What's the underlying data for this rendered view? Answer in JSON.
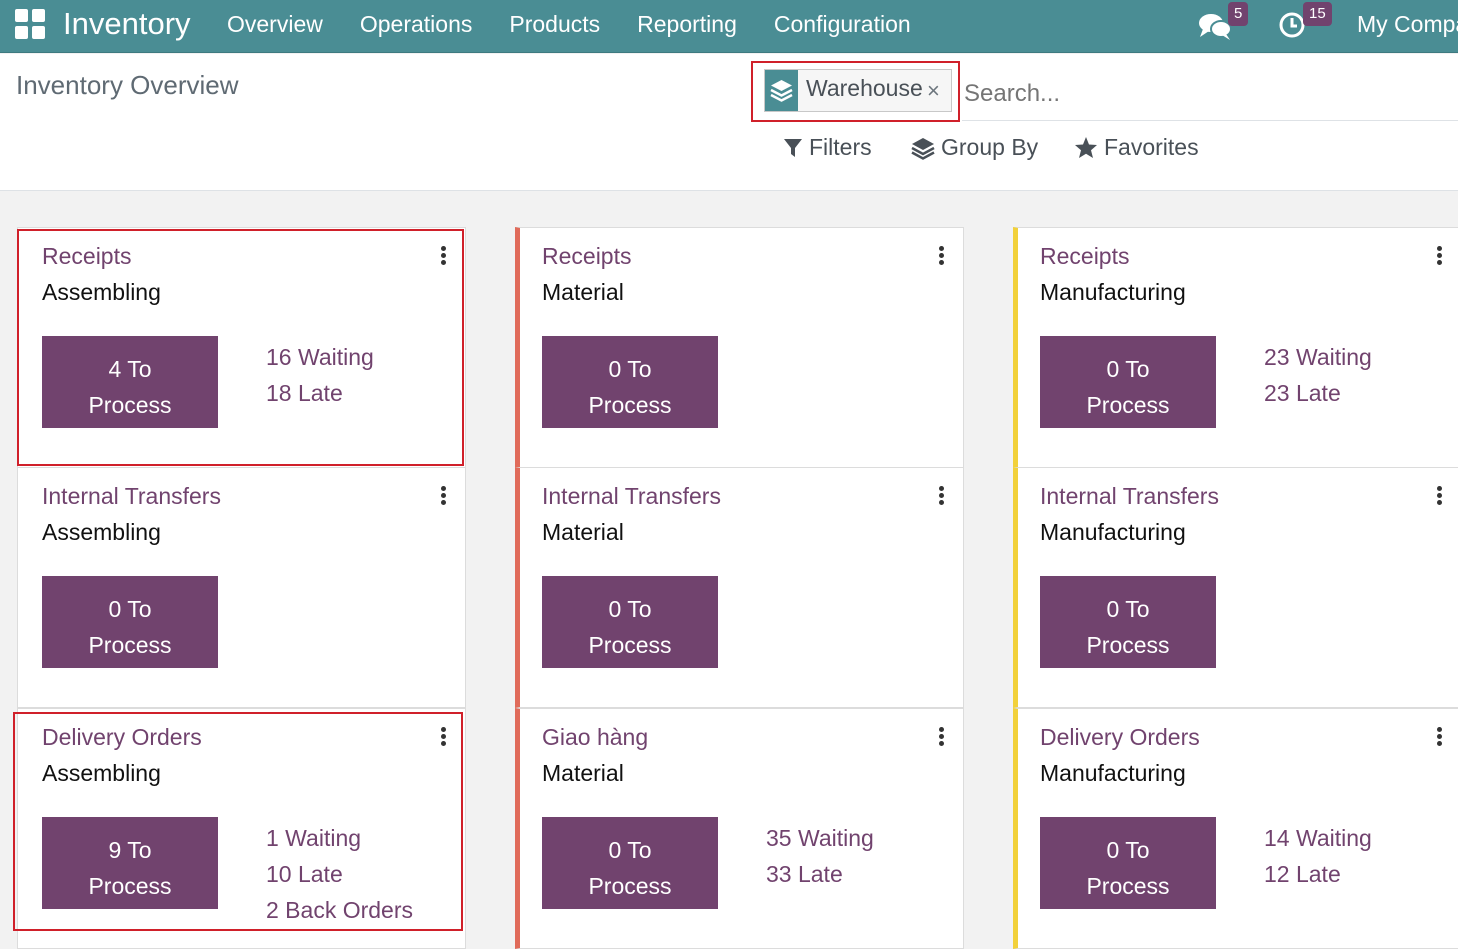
{
  "navbar": {
    "app_name": "Inventory",
    "menu": [
      "Overview",
      "Operations",
      "Products",
      "Reporting",
      "Configuration"
    ],
    "messages_count": "5",
    "activities_count": "15",
    "company": "My Company"
  },
  "control_panel": {
    "title": "Inventory Overview",
    "facet_label": "Warehouse",
    "facet_close": "×",
    "search_placeholder": "Search...",
    "filters_label": "Filters",
    "group_by_label": "Group By",
    "favorites_label": "Favorites"
  },
  "colors": {
    "navbar": "#4a8d94",
    "primary": "#71436e",
    "material_stripe": "#e06b5a",
    "manufacturing_stripe": "#f2d13a",
    "highlight": "#d0202a"
  },
  "cards": [
    {
      "title": "Receipts",
      "warehouse": "Assembling",
      "process_line1": "4 To",
      "process_line2": "Process",
      "stats": [
        "16 Waiting",
        "18 Late"
      ]
    },
    {
      "title": "Receipts",
      "warehouse": "Material",
      "process_line1": "0 To",
      "process_line2": "Process",
      "stats": []
    },
    {
      "title": "Receipts",
      "warehouse": "Manufacturing",
      "process_line1": "0 To",
      "process_line2": "Process",
      "stats": [
        "23 Waiting",
        "23 Late"
      ]
    },
    {
      "title": "Internal Transfers",
      "warehouse": "Assembling",
      "process_line1": "0 To",
      "process_line2": "Process",
      "stats": []
    },
    {
      "title": "Internal Transfers",
      "warehouse": "Material",
      "process_line1": "0 To",
      "process_line2": "Process",
      "stats": []
    },
    {
      "title": "Internal Transfers",
      "warehouse": "Manufacturing",
      "process_line1": "0 To",
      "process_line2": "Process",
      "stats": []
    },
    {
      "title": "Delivery Orders",
      "warehouse": "Assembling",
      "process_line1": "9 To",
      "process_line2": "Process",
      "stats": [
        "1 Waiting",
        "10 Late",
        "2 Back Orders"
      ]
    },
    {
      "title": "Giao hàng",
      "warehouse": "Material",
      "process_line1": "0 To",
      "process_line2": "Process",
      "stats": [
        "35 Waiting",
        "33 Late"
      ]
    },
    {
      "title": "Delivery Orders",
      "warehouse": "Manufacturing",
      "process_line1": "0 To",
      "process_line2": "Process",
      "stats": [
        "14 Waiting",
        "12 Late"
      ]
    }
  ]
}
